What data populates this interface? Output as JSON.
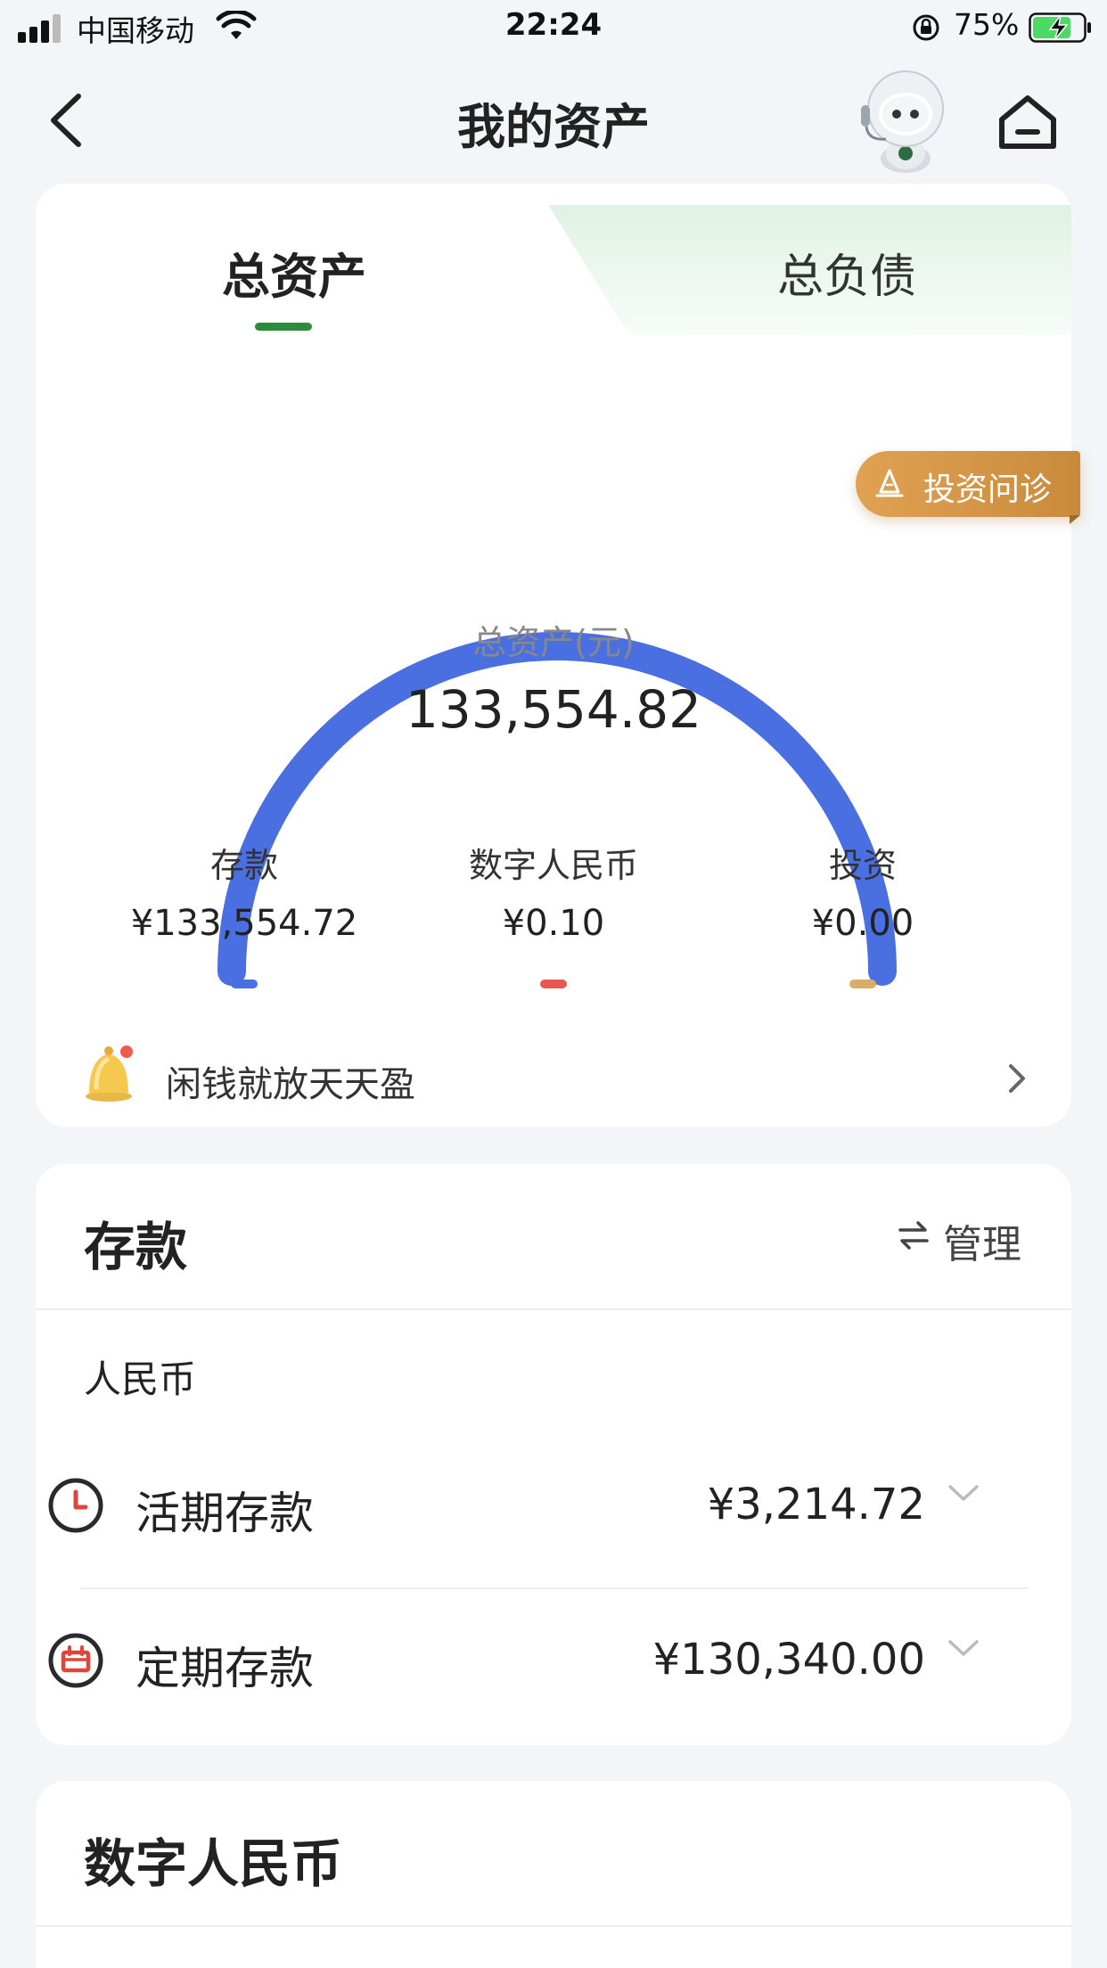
{
  "status_bar": {
    "carrier": "中国移动",
    "time": "22:24",
    "battery": "75%"
  },
  "nav": {
    "title": "我的资产"
  },
  "tabs": {
    "assets": "总资产",
    "liabilities": "总负债"
  },
  "invest_badge": "投资问诊",
  "gauge": {
    "caption": "总资产(元)",
    "total": "133,554.82",
    "shares": {
      "deposit": 133554.72,
      "dcep": 0.1,
      "investment": 0.0
    }
  },
  "breakdown": [
    {
      "label": "存款",
      "amount": "¥133,554.72",
      "color": "#4a6fe0"
    },
    {
      "label": "数字人民币",
      "amount": "¥0.10",
      "color": "#e6584e"
    },
    {
      "label": "投资",
      "amount": "¥0.00",
      "color": "#d9ad67"
    }
  ],
  "tip": "闲钱就放天天盈",
  "deposit": {
    "title": "存款",
    "manage": "管理",
    "currency": "人民币",
    "rows": [
      {
        "name": "活期存款",
        "amount": "¥3,214.72",
        "icon": "clock-icon"
      },
      {
        "name": "定期存款",
        "amount": "¥130,340.00",
        "icon": "calendar-icon"
      }
    ]
  },
  "dcep": {
    "title": "数字人民币"
  },
  "colors": {
    "accent_green": "#2e8b3a",
    "gauge_blue": "#4a6fe0",
    "badge_gold": "#d4974a"
  }
}
